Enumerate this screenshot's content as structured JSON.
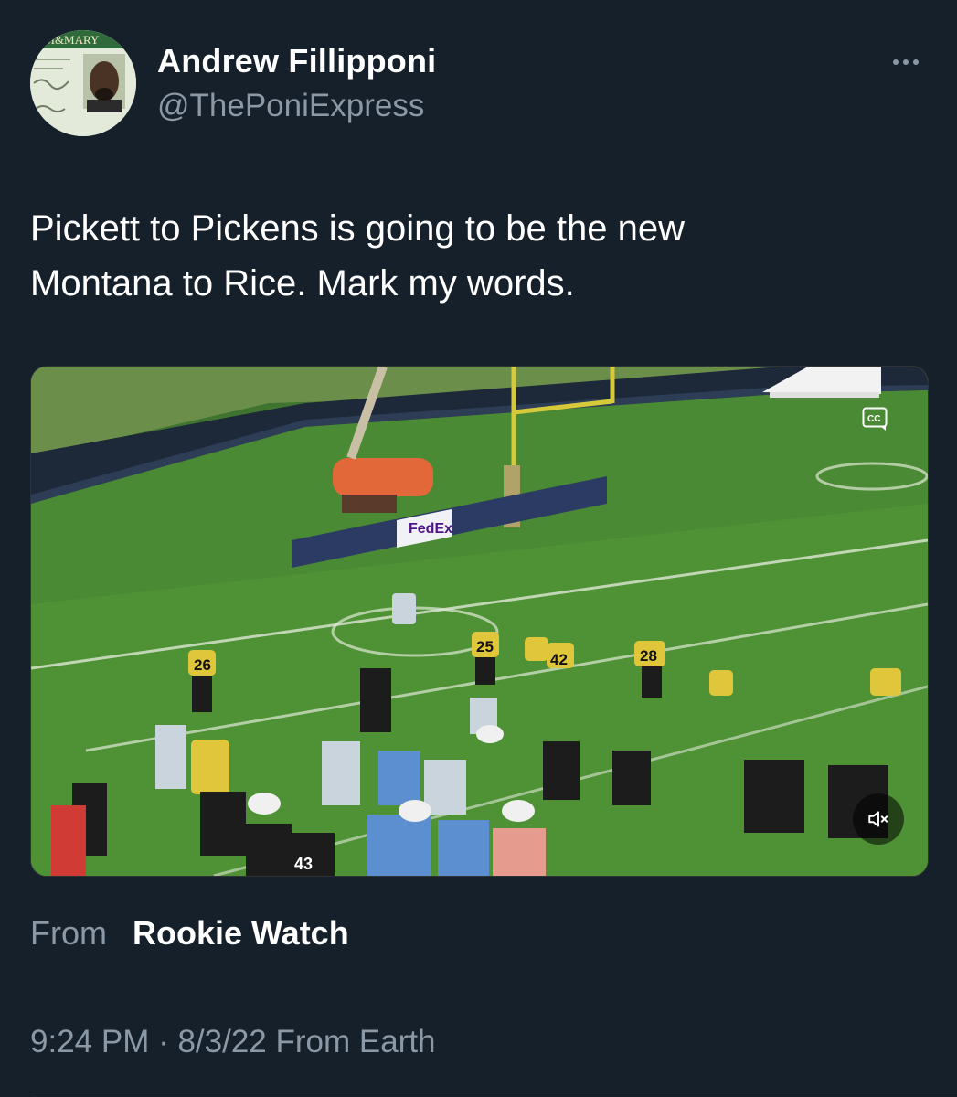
{
  "author": {
    "name": "Andrew Fillipponi",
    "handle": "@ThePoniExpress",
    "avatar_card_text": "AM&MARY"
  },
  "tweet": {
    "text": "Pickett to Pickens is going to be the new\nMontana to Rice. Mark my words."
  },
  "media": {
    "type": "video",
    "jersey_numbers": [
      "26",
      "25",
      "42",
      "28",
      "43"
    ],
    "banner_brand": "FedEx",
    "icons": [
      "closed-captions-icon",
      "mute-icon"
    ]
  },
  "source": {
    "prefix": "From",
    "name": "Rookie Watch"
  },
  "meta": {
    "timestamp": "9:24 PM · 8/3/22 From Earth"
  },
  "colors": {
    "background": "#15202b",
    "primary_text": "#ffffff",
    "secondary_text": "#8b98a5"
  }
}
